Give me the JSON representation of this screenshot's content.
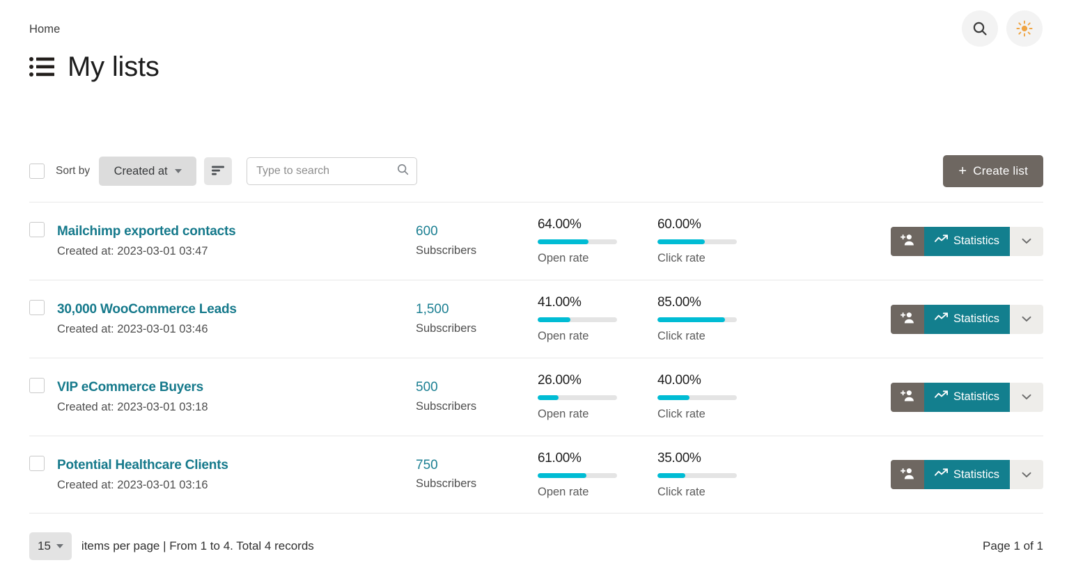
{
  "header": {
    "breadcrumb": "Home",
    "title": "My lists",
    "search_icon": "search-icon",
    "theme_icon": "sun-icon"
  },
  "toolbar": {
    "select_all_checkbox": "",
    "sort_by_label": "Sort by",
    "sort_field": "Created at",
    "sort_direction_icon": "sort-lines-icon",
    "search_placeholder": "Type to search",
    "search_value": "",
    "create_button": "Create list",
    "create_button_plus": "+"
  },
  "list": {
    "rows": [
      {
        "name": "Mailchimp exported contacts",
        "created": "Created at: 2023-03-01 03:47",
        "subscribers": "600",
        "subscribers_label": "Subscribers",
        "open_rate": "64.00%",
        "open_rate_value": 64,
        "open_rate_label": "Open rate",
        "click_rate": "60.00%",
        "click_rate_value": 60,
        "click_rate_label": "Click rate",
        "add_icon": "add-subscriber-icon",
        "stats_label": "Statistics",
        "stats_icon": "chart-trend-icon",
        "more_icon": "chevron-down-icon"
      },
      {
        "name": "30,000 WooCommerce Leads",
        "created": "Created at: 2023-03-01 03:46",
        "subscribers": "1,500",
        "subscribers_label": "Subscribers",
        "open_rate": "41.00%",
        "open_rate_value": 41,
        "open_rate_label": "Open rate",
        "click_rate": "85.00%",
        "click_rate_value": 85,
        "click_rate_label": "Click rate",
        "add_icon": "add-subscriber-icon",
        "stats_label": "Statistics",
        "stats_icon": "chart-trend-icon",
        "more_icon": "chevron-down-icon"
      },
      {
        "name": "VIP eCommerce Buyers",
        "created": "Created at: 2023-03-01 03:18",
        "subscribers": "500",
        "subscribers_label": "Subscribers",
        "open_rate": "26.00%",
        "open_rate_value": 26,
        "open_rate_label": "Open rate",
        "click_rate": "40.00%",
        "click_rate_value": 40,
        "click_rate_label": "Click rate",
        "add_icon": "add-subscriber-icon",
        "stats_label": "Statistics",
        "stats_icon": "chart-trend-icon",
        "more_icon": "chevron-down-icon"
      },
      {
        "name": "Potential Healthcare Clients",
        "created": "Created at: 2023-03-01 03:16",
        "subscribers": "750",
        "subscribers_label": "Subscribers",
        "open_rate": "61.00%",
        "open_rate_value": 61,
        "open_rate_label": "Open rate",
        "click_rate": "35.00%",
        "click_rate_value": 35,
        "click_rate_label": "Click rate",
        "add_icon": "add-subscriber-icon",
        "stats_label": "Statistics",
        "stats_icon": "chart-trend-icon",
        "more_icon": "chevron-down-icon"
      }
    ]
  },
  "footer": {
    "per_page": "15",
    "per_page_text": "items per page  | From 1 to 4. Total 4 records",
    "page_info": "Page 1 of 1"
  },
  "colors": {
    "teal_link": "#15798b",
    "teal_button": "#137f8e",
    "brown_button": "#6e6761",
    "progress_fill": "#00bcd4",
    "progress_track": "#e4e4e4",
    "sun_icon": "#efa443"
  }
}
